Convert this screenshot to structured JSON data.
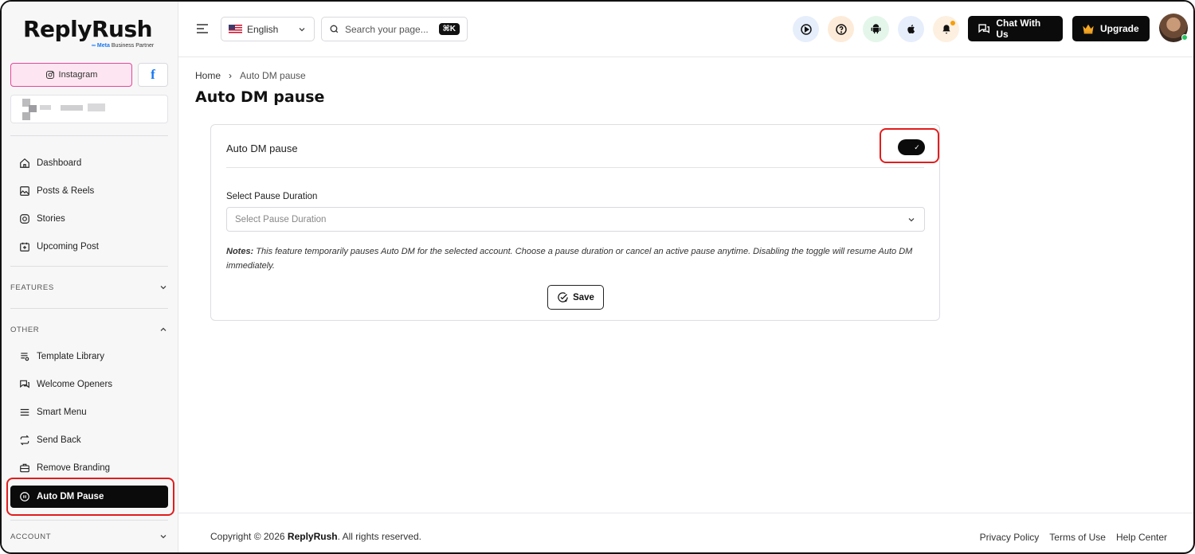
{
  "brand": {
    "name": "ReplyRush",
    "partner_prefix": "∞ Meta",
    "partner_suffix": "Business Partner"
  },
  "sidebar": {
    "instagram_label": "Instagram",
    "facebook_label": "f",
    "nav": [
      {
        "label": "Dashboard",
        "icon": "home-icon"
      },
      {
        "label": "Posts & Reels",
        "icon": "image-icon"
      },
      {
        "label": "Stories",
        "icon": "instagram-icon"
      },
      {
        "label": "Upcoming Post",
        "icon": "calendar-plus-icon"
      }
    ],
    "features_label": "FEATURES",
    "other_label": "OTHER",
    "other_items": [
      {
        "label": "Template Library",
        "icon": "template-icon"
      },
      {
        "label": "Welcome Openers",
        "icon": "chat-icon"
      },
      {
        "label": "Smart Menu",
        "icon": "menu-lines-icon"
      },
      {
        "label": "Send Back",
        "icon": "repeat-icon"
      },
      {
        "label": "Remove Branding",
        "icon": "briefcase-icon"
      },
      {
        "label": "Auto DM Pause",
        "icon": "pause-circle-icon",
        "active": true
      }
    ],
    "account_label": "ACCOUNT"
  },
  "header": {
    "language": "English",
    "search_placeholder": "Search your page...",
    "search_shortcut": "⌘K",
    "chat_label": "Chat With Us",
    "upgrade_label": "Upgrade",
    "icons": [
      "play-icon",
      "help-icon",
      "android-icon",
      "apple-icon",
      "bell-icon"
    ]
  },
  "breadcrumb": {
    "home": "Home",
    "separator": "›",
    "current": "Auto DM pause"
  },
  "page_title": "Auto DM pause",
  "card": {
    "title": "Auto DM pause",
    "toggle_on": true,
    "field_label": "Select Pause Duration",
    "select_placeholder": "Select Pause Duration",
    "notes_label": "Notes:",
    "notes_text": "This feature temporarily pauses Auto DM for the selected account. Choose a pause duration or cancel an active pause anytime. Disabling the toggle will resume Auto DM immediately.",
    "save_label": "Save"
  },
  "footer": {
    "copy_prefix": "Copyright © 2026",
    "copy_brand": "ReplyRush",
    "copy_suffix": ". All rights reserved.",
    "links": [
      "Privacy Policy",
      "Terms of Use",
      "Help Center"
    ]
  },
  "colors": {
    "accent": "#0b0b0b",
    "highlight": "#e11d1d",
    "instagram": "#e4479a",
    "facebook": "#1877f2",
    "online": "#22c55e"
  }
}
